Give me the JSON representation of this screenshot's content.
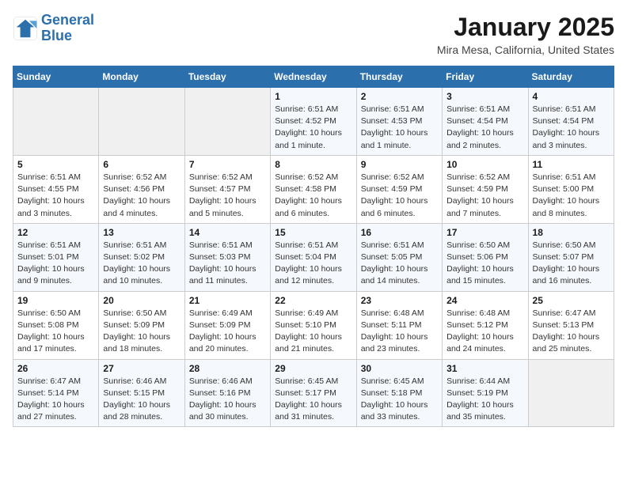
{
  "header": {
    "logo_line1": "General",
    "logo_line2": "Blue",
    "month": "January 2025",
    "location": "Mira Mesa, California, United States"
  },
  "days_of_week": [
    "Sunday",
    "Monday",
    "Tuesday",
    "Wednesday",
    "Thursday",
    "Friday",
    "Saturday"
  ],
  "weeks": [
    [
      {
        "day": "",
        "sunrise": "",
        "sunset": "",
        "daylight": ""
      },
      {
        "day": "",
        "sunrise": "",
        "sunset": "",
        "daylight": ""
      },
      {
        "day": "",
        "sunrise": "",
        "sunset": "",
        "daylight": ""
      },
      {
        "day": "1",
        "sunrise": "Sunrise: 6:51 AM",
        "sunset": "Sunset: 4:52 PM",
        "daylight": "Daylight: 10 hours and 1 minute."
      },
      {
        "day": "2",
        "sunrise": "Sunrise: 6:51 AM",
        "sunset": "Sunset: 4:53 PM",
        "daylight": "Daylight: 10 hours and 1 minute."
      },
      {
        "day": "3",
        "sunrise": "Sunrise: 6:51 AM",
        "sunset": "Sunset: 4:54 PM",
        "daylight": "Daylight: 10 hours and 2 minutes."
      },
      {
        "day": "4",
        "sunrise": "Sunrise: 6:51 AM",
        "sunset": "Sunset: 4:54 PM",
        "daylight": "Daylight: 10 hours and 3 minutes."
      }
    ],
    [
      {
        "day": "5",
        "sunrise": "Sunrise: 6:51 AM",
        "sunset": "Sunset: 4:55 PM",
        "daylight": "Daylight: 10 hours and 3 minutes."
      },
      {
        "day": "6",
        "sunrise": "Sunrise: 6:52 AM",
        "sunset": "Sunset: 4:56 PM",
        "daylight": "Daylight: 10 hours and 4 minutes."
      },
      {
        "day": "7",
        "sunrise": "Sunrise: 6:52 AM",
        "sunset": "Sunset: 4:57 PM",
        "daylight": "Daylight: 10 hours and 5 minutes."
      },
      {
        "day": "8",
        "sunrise": "Sunrise: 6:52 AM",
        "sunset": "Sunset: 4:58 PM",
        "daylight": "Daylight: 10 hours and 6 minutes."
      },
      {
        "day": "9",
        "sunrise": "Sunrise: 6:52 AM",
        "sunset": "Sunset: 4:59 PM",
        "daylight": "Daylight: 10 hours and 6 minutes."
      },
      {
        "day": "10",
        "sunrise": "Sunrise: 6:52 AM",
        "sunset": "Sunset: 4:59 PM",
        "daylight": "Daylight: 10 hours and 7 minutes."
      },
      {
        "day": "11",
        "sunrise": "Sunrise: 6:51 AM",
        "sunset": "Sunset: 5:00 PM",
        "daylight": "Daylight: 10 hours and 8 minutes."
      }
    ],
    [
      {
        "day": "12",
        "sunrise": "Sunrise: 6:51 AM",
        "sunset": "Sunset: 5:01 PM",
        "daylight": "Daylight: 10 hours and 9 minutes."
      },
      {
        "day": "13",
        "sunrise": "Sunrise: 6:51 AM",
        "sunset": "Sunset: 5:02 PM",
        "daylight": "Daylight: 10 hours and 10 minutes."
      },
      {
        "day": "14",
        "sunrise": "Sunrise: 6:51 AM",
        "sunset": "Sunset: 5:03 PM",
        "daylight": "Daylight: 10 hours and 11 minutes."
      },
      {
        "day": "15",
        "sunrise": "Sunrise: 6:51 AM",
        "sunset": "Sunset: 5:04 PM",
        "daylight": "Daylight: 10 hours and 12 minutes."
      },
      {
        "day": "16",
        "sunrise": "Sunrise: 6:51 AM",
        "sunset": "Sunset: 5:05 PM",
        "daylight": "Daylight: 10 hours and 14 minutes."
      },
      {
        "day": "17",
        "sunrise": "Sunrise: 6:50 AM",
        "sunset": "Sunset: 5:06 PM",
        "daylight": "Daylight: 10 hours and 15 minutes."
      },
      {
        "day": "18",
        "sunrise": "Sunrise: 6:50 AM",
        "sunset": "Sunset: 5:07 PM",
        "daylight": "Daylight: 10 hours and 16 minutes."
      }
    ],
    [
      {
        "day": "19",
        "sunrise": "Sunrise: 6:50 AM",
        "sunset": "Sunset: 5:08 PM",
        "daylight": "Daylight: 10 hours and 17 minutes."
      },
      {
        "day": "20",
        "sunrise": "Sunrise: 6:50 AM",
        "sunset": "Sunset: 5:09 PM",
        "daylight": "Daylight: 10 hours and 18 minutes."
      },
      {
        "day": "21",
        "sunrise": "Sunrise: 6:49 AM",
        "sunset": "Sunset: 5:09 PM",
        "daylight": "Daylight: 10 hours and 20 minutes."
      },
      {
        "day": "22",
        "sunrise": "Sunrise: 6:49 AM",
        "sunset": "Sunset: 5:10 PM",
        "daylight": "Daylight: 10 hours and 21 minutes."
      },
      {
        "day": "23",
        "sunrise": "Sunrise: 6:48 AM",
        "sunset": "Sunset: 5:11 PM",
        "daylight": "Daylight: 10 hours and 23 minutes."
      },
      {
        "day": "24",
        "sunrise": "Sunrise: 6:48 AM",
        "sunset": "Sunset: 5:12 PM",
        "daylight": "Daylight: 10 hours and 24 minutes."
      },
      {
        "day": "25",
        "sunrise": "Sunrise: 6:47 AM",
        "sunset": "Sunset: 5:13 PM",
        "daylight": "Daylight: 10 hours and 25 minutes."
      }
    ],
    [
      {
        "day": "26",
        "sunrise": "Sunrise: 6:47 AM",
        "sunset": "Sunset: 5:14 PM",
        "daylight": "Daylight: 10 hours and 27 minutes."
      },
      {
        "day": "27",
        "sunrise": "Sunrise: 6:46 AM",
        "sunset": "Sunset: 5:15 PM",
        "daylight": "Daylight: 10 hours and 28 minutes."
      },
      {
        "day": "28",
        "sunrise": "Sunrise: 6:46 AM",
        "sunset": "Sunset: 5:16 PM",
        "daylight": "Daylight: 10 hours and 30 minutes."
      },
      {
        "day": "29",
        "sunrise": "Sunrise: 6:45 AM",
        "sunset": "Sunset: 5:17 PM",
        "daylight": "Daylight: 10 hours and 31 minutes."
      },
      {
        "day": "30",
        "sunrise": "Sunrise: 6:45 AM",
        "sunset": "Sunset: 5:18 PM",
        "daylight": "Daylight: 10 hours and 33 minutes."
      },
      {
        "day": "31",
        "sunrise": "Sunrise: 6:44 AM",
        "sunset": "Sunset: 5:19 PM",
        "daylight": "Daylight: 10 hours and 35 minutes."
      },
      {
        "day": "",
        "sunrise": "",
        "sunset": "",
        "daylight": ""
      }
    ]
  ]
}
